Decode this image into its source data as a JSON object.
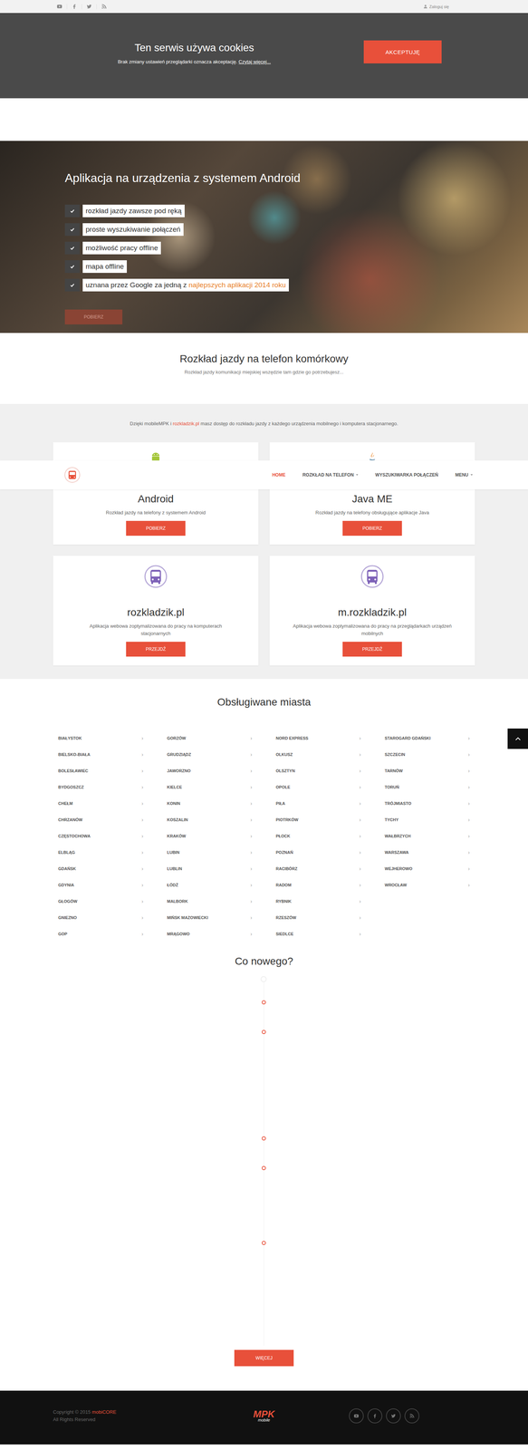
{
  "top_bar": {
    "login": "Zaloguj się"
  },
  "cookie": {
    "title": "Ten serwis używa cookies",
    "text": "Brak zmiany ustawień przeglądarki oznacza akceptację. ",
    "link": "Czytaj więcej...",
    "button": "AKCEPTUJĘ"
  },
  "hero": {
    "title": "Aplikacja na urządzenia z systemem Android",
    "features": [
      {
        "text": "rozkład jazdy zawsze pod ręką",
        "highlight": ""
      },
      {
        "text": "proste wyszukiwanie połączeń",
        "highlight": ""
      },
      {
        "text": "możliwość pracy offline",
        "highlight": ""
      },
      {
        "text": "mapa offline",
        "highlight": ""
      },
      {
        "text": "uznana przez Google za jedną z ",
        "highlight": "najlepszych aplikacji 2014 roku"
      }
    ],
    "button": "POBIERZ",
    "button_disabled": true
  },
  "intro": {
    "title": "Rozkład jazdy na telefon komórkowy",
    "subtitle": "Rozkład jazdy komunikacji miejskiej wszędzie tam gdzie go potrzebujesz..."
  },
  "apps": {
    "lead_before": "Dzięki mobileMPK i ",
    "lead_link": "rozkladzik.pl",
    "lead_after": " masz dostęp do rozkładu jazdy z każdego urządzenia mobilnego i komputera stacjonarnego.",
    "cards": [
      {
        "kind": "android",
        "title": "Android",
        "description": "Rozkład jazdy na telefony z systemem Android",
        "button": "POBIERZ"
      },
      {
        "kind": "java",
        "title": "Java ME",
        "description": "Rozkład jazdy na telefony obsługujące aplikacje Java",
        "button": "POBIERZ"
      },
      {
        "kind": "web",
        "title": "rozkladzik.pl",
        "description": "Aplikacja webowa zoptymalizowana do pracy na komputerach stacjonarnych",
        "button": "PRZEJDŹ"
      },
      {
        "kind": "web",
        "title": "m.rozkladzik.pl",
        "description": "Aplikacja webowa zoptymalizowana do pracy na przeglądarkach urządzeń mobilnych",
        "button": "PRZEJDŹ"
      }
    ]
  },
  "nav": {
    "items": [
      {
        "label": "HOME",
        "selected": true,
        "dropdown": false
      },
      {
        "label": "ROZKŁAD NA TELEFON",
        "selected": false,
        "dropdown": true
      },
      {
        "label": "WYSZUKIWARKA POŁĄCZEŃ",
        "selected": false,
        "dropdown": false
      },
      {
        "label": "MENU",
        "selected": false,
        "dropdown": true
      }
    ]
  },
  "cities": {
    "title": "Obsługiwane miasta",
    "chevron": "›",
    "columns": [
      [
        "BIAŁYSTOK",
        "BIELSKO-BIAŁA",
        "BOLESŁAWIEC",
        "BYDGOSZCZ",
        "CHEŁM",
        "CHRZANÓW",
        "CZĘSTOCHOWA",
        "ELBLĄG",
        "GDAŃSK",
        "GDYNIA",
        "GŁOGÓW",
        "GNIEZNO",
        "GOP"
      ],
      [
        "GORZÓW",
        "GRUDZIĄDZ",
        "JAWORZNO",
        "KIELCE",
        "KONIN",
        "KOSZALIN",
        "KRAKÓW",
        "LUBIN",
        "LUBLIN",
        "ŁÓDŹ",
        "MALBORK",
        "MIŃSK MAZOWIECKI",
        "MRĄGOWO"
      ],
      [
        "NORD EXPRESS",
        "OLKUSZ",
        "OLSZTYN",
        "OPOLE",
        "PIŁA",
        "PIOTRKÓW",
        "PŁOCK",
        "POZNAŃ",
        "RACIBÓRZ",
        "RADOM",
        "RYBNIK",
        "RZESZÓW",
        "SIEDLCE"
      ],
      [
        "STAROGARD GDAŃSKI",
        "SZCZECIN",
        "TARNÓW",
        "TORUŃ",
        "TRÓJMIASTO",
        "TYCHY",
        "WAŁBRZYCH",
        "WARSZAWA",
        "WEJHEROWO",
        "WROCŁAW"
      ]
    ]
  },
  "news": {
    "title": "Co nowego?",
    "button": "WIĘCEJ"
  },
  "footer": {
    "copyright": "Copyright © 2015 ",
    "brand": "mobiCORE",
    "rights": "All Rights Reserved",
    "logo_top": "MPK",
    "logo_bottom": "mobile"
  }
}
